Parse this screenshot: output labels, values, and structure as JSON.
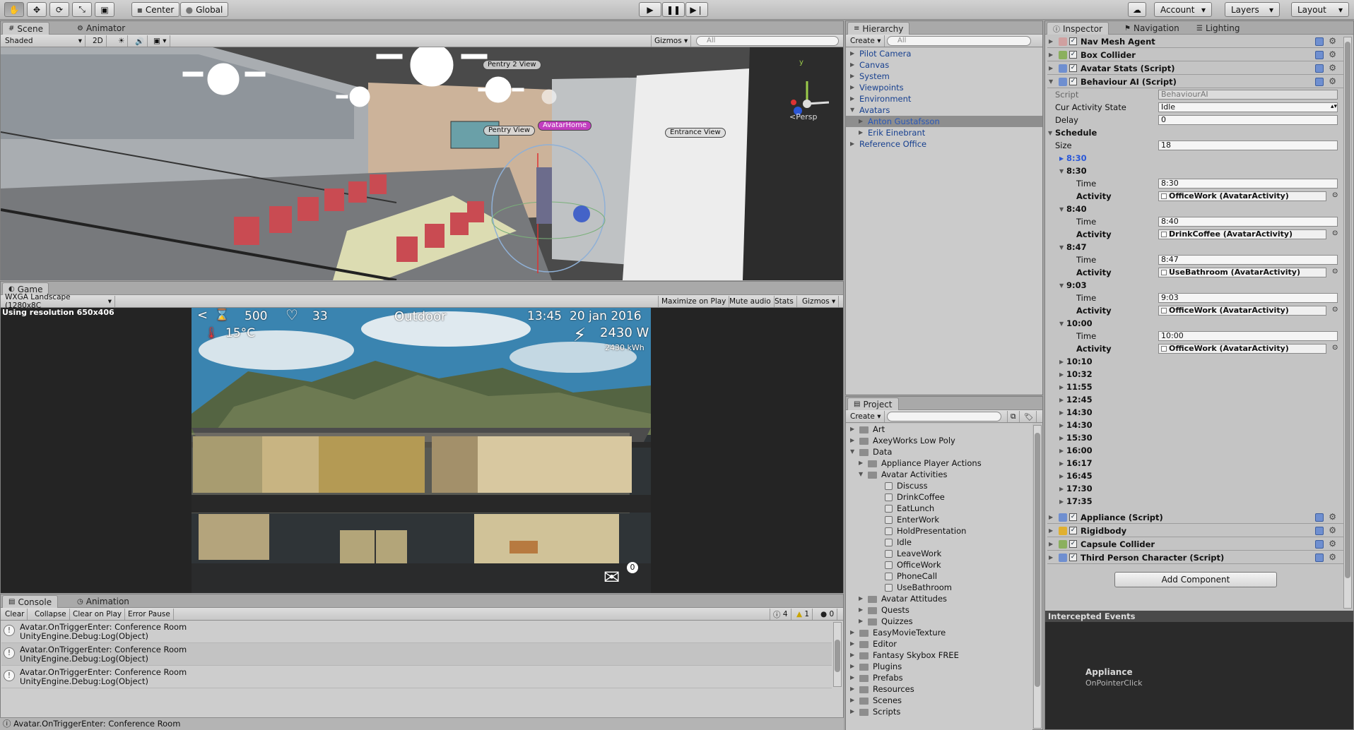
{
  "toolbar": {
    "center": "Center",
    "global": "Global",
    "account": "Account",
    "layers": "Layers",
    "layout": "Layout"
  },
  "scene": {
    "tab": "Scene",
    "tab2": "Animator",
    "shade": "Shaded",
    "twoD": "2D",
    "gizmos": "Gizmos",
    "search": "All",
    "persp": "Persp",
    "labels": {
      "pentry2": "Pentry 2 View",
      "pentry": "Pentry View",
      "avatarhome": "AvatarHome",
      "entrance": "Entrance View"
    }
  },
  "game": {
    "tab": "Game",
    "res": "WXGA Landscape (1280x8C",
    "maximize": "Maximize on Play",
    "mute": "Mute audio",
    "stats": "Stats",
    "gizmos": "Gizmos",
    "using": "Using resolution 650x406",
    "hud": {
      "back": "<",
      "money": "500",
      "heart": "33",
      "temp": "15°C",
      "mode": "Outdoor",
      "time": "13:45",
      "date": "20 jan 2016",
      "watts": "2430 W",
      "kwh": "2430 kWh",
      "mail": "0"
    }
  },
  "console": {
    "tab": "Console",
    "tab2": "Animation",
    "clear": "Clear",
    "collapse": "Collapse",
    "clearplay": "Clear on Play",
    "errpause": "Error Pause",
    "count_info": "4",
    "count_warn": "1",
    "count_err": "0",
    "rows": [
      {
        "line1": "Avatar.OnTriggerEnter: Conference Room",
        "line2": "UnityEngine.Debug:Log(Object)"
      },
      {
        "line1": "Avatar.OnTriggerEnter: Conference Room",
        "line2": "UnityEngine.Debug:Log(Object)"
      },
      {
        "line1": "Avatar.OnTriggerEnter: Conference Room",
        "line2": "UnityEngine.Debug:Log(Object)"
      }
    ],
    "status": "Avatar.OnTriggerEnter: Conference Room"
  },
  "hierarchy": {
    "tab": "Hierarchy",
    "create": "Create",
    "search": "All",
    "items": [
      "Pilot Camera",
      "Canvas",
      "System",
      "Viewpoints",
      "Environment",
      "Avatars",
      "Anton Gustafsson",
      "Erik Einebrant",
      "Reference Office"
    ]
  },
  "project": {
    "tab": "Project",
    "create": "Create",
    "items": [
      "Art",
      "AxeyWorks Low Poly",
      "Data",
      "Appliance Player Actions",
      "Avatar Activities",
      "Discuss",
      "DrinkCoffee",
      "EatLunch",
      "EnterWork",
      "HoldPresentation",
      "Idle",
      "LeaveWork",
      "OfficeWork",
      "PhoneCall",
      "UseBathroom",
      "Avatar Attitudes",
      "Quests",
      "Quizzes",
      "EasyMovieTexture",
      "Editor",
      "Fantasy Skybox FREE",
      "Plugins",
      "Prefabs",
      "Resources",
      "Scenes",
      "Scripts"
    ]
  },
  "inspector": {
    "tab": "Inspector",
    "tab2": "Navigation",
    "tab3": "Lighting",
    "components_top": [
      "Nav Mesh Agent",
      "Box Collider",
      "Avatar Stats (Script)",
      "Behaviour AI (Script)"
    ],
    "script_label": "Script",
    "script_value": "BehaviourAI",
    "cur_label": "Cur Activity State",
    "cur_value": "Idle",
    "delay_label": "Delay",
    "delay_value": "0",
    "schedule": "Schedule",
    "size_label": "Size",
    "size_value": "18",
    "first": "8:30",
    "time_label": "Time",
    "activity_label": "Activity",
    "entries": [
      {
        "head": "8:30",
        "time": "8:30",
        "activity": "OfficeWork (AvatarActivity)"
      },
      {
        "head": "8:40",
        "time": "8:40",
        "activity": "DrinkCoffee (AvatarActivity)"
      },
      {
        "head": "8:47",
        "time": "8:47",
        "activity": "UseBathroom (AvatarActivity)"
      },
      {
        "head": "9:03",
        "time": "9:03",
        "activity": "OfficeWork (AvatarActivity)"
      },
      {
        "head": "10:00",
        "time": "10:00",
        "activity": "OfficeWork (AvatarActivity)"
      }
    ],
    "collapsed": [
      "10:10",
      "10:32",
      "11:55",
      "12:45",
      "14:30",
      "14:30",
      "15:30",
      "16:00",
      "16:17",
      "16:45",
      "17:30",
      "17:35"
    ],
    "components_bottom": [
      "Appliance (Script)",
      "Rigidbody",
      "Capsule Collider",
      "Third Person Character (Script)"
    ],
    "add": "Add Component",
    "events_title": "Intercepted Events",
    "event_name": "Appliance",
    "event_sub": "OnPointerClick"
  }
}
